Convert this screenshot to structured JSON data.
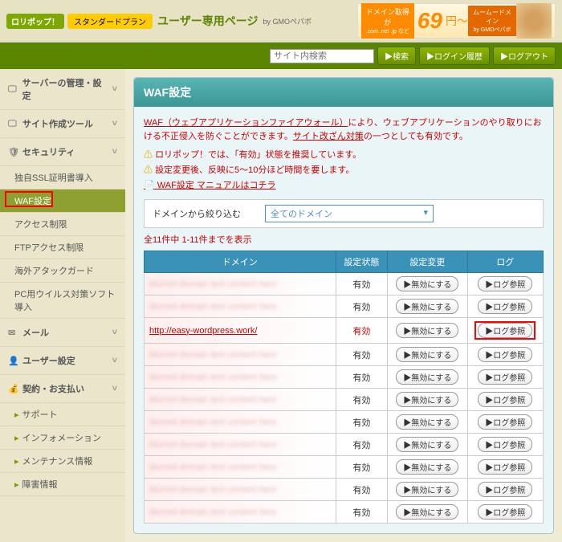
{
  "header": {
    "lollipop": "ロリポップ！",
    "plan": "スタンダードプラン",
    "user_page": "ユーザー専用ページ",
    "gmo": "by GMOペパボ"
  },
  "banner": {
    "left_top": "ドメイン取得が",
    "left_sub": ".com .net .jp など",
    "price": "69",
    "yen": "円～",
    "right_top": "ムームードメイン",
    "right_sub": "by GMOペパボ"
  },
  "search": {
    "placeholder": "サイト内検索",
    "search_btn": "▶検索",
    "login_history_btn": "▶ログイン履歴",
    "logout_btn": "▶ログアウト"
  },
  "sidebar": {
    "items": [
      {
        "icon": "server",
        "label": "サーバーの管理・設定",
        "arrow": "˅"
      },
      {
        "icon": "monitor",
        "label": "サイト作成ツール",
        "arrow": "˅"
      },
      {
        "icon": "shield",
        "label": "セキュリティ",
        "arrow": "˅",
        "expanded": true,
        "subs": [
          {
            "label": "独自SSL証明書導入"
          },
          {
            "label": "WAF設定",
            "active": true
          },
          {
            "label": "アクセス制限"
          },
          {
            "label": "FTPアクセス制限"
          },
          {
            "label": "海外アタックガード"
          },
          {
            "label": "PC用ウイルス対策ソフト導入"
          }
        ]
      },
      {
        "icon": "mail",
        "label": "メール",
        "arrow": "˅"
      },
      {
        "icon": "user",
        "label": "ユーザー設定",
        "arrow": "˅"
      },
      {
        "icon": "money",
        "label": "契約・お支払い",
        "arrow": "˅"
      }
    ],
    "footer": [
      {
        "label": "サポート"
      },
      {
        "label": "インフォメーション"
      },
      {
        "label": "メンテナンス情報"
      },
      {
        "label": "障害情報"
      }
    ]
  },
  "panel": {
    "title": "WAF設定",
    "info_prefix": "",
    "waf_link": "WAF（ウェブアプリケーションファイアウォール）",
    "info_mid": "により、ウェブアプリケーションのやり取りにおける不正侵入を防ぐことができます。",
    "info_link2": "サイト改ざん対策",
    "info_suffix": "の一つとしても有効です。",
    "warn1": "ロリポップ！では、「有効」状態を推奨しています。",
    "warn2": "設定変更後、反映に5～10分ほど時間を要します。",
    "manual": "WAF設定 マニュアルはコチラ",
    "filter_label": "ドメインから絞り込む",
    "filter_value": "全てのドメイン",
    "count": "全11件中 1-11件までを表示",
    "cols": {
      "domain": "ドメイン",
      "status": "設定状態",
      "change": "設定変更",
      "log": "ログ"
    },
    "btn_disable": "▶無効にする",
    "btn_log": "▶ログ参照",
    "rows": [
      {
        "domain": "",
        "status": "有効",
        "link": false,
        "hl": false
      },
      {
        "domain": "",
        "status": "有効",
        "link": false,
        "hl": false
      },
      {
        "domain": "http://easy-wordpress.work/",
        "status": "有効",
        "link": true,
        "hl": true
      },
      {
        "domain": "",
        "status": "有効",
        "link": false,
        "hl": false
      },
      {
        "domain": "",
        "status": "有効",
        "link": false,
        "hl": false
      },
      {
        "domain": "",
        "status": "有効",
        "link": false,
        "hl": false
      },
      {
        "domain": "",
        "status": "有効",
        "link": false,
        "hl": false
      },
      {
        "domain": "",
        "status": "有効",
        "link": false,
        "hl": false
      },
      {
        "domain": "",
        "status": "有効",
        "link": false,
        "hl": false
      },
      {
        "domain": "",
        "status": "有効",
        "link": false,
        "hl": false
      },
      {
        "domain": "",
        "status": "有効",
        "link": false,
        "hl": false
      }
    ]
  }
}
